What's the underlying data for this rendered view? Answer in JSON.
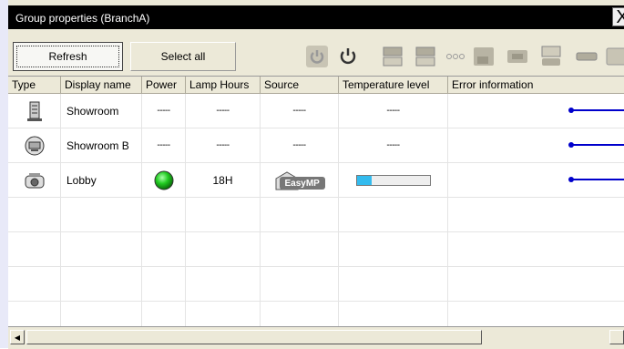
{
  "window": {
    "title": "Group properties (BranchA)",
    "close_glyph": "X"
  },
  "toolbar": {
    "refresh_label": "Refresh",
    "select_all_label": "Select all",
    "icons": [
      "power-on-icon",
      "power-off-icon",
      "computer-source-icon",
      "video-source-icon",
      "av-mute-icon",
      "freeze-icon",
      "display-icon",
      "usb-icon",
      "hdmi-icon",
      "more-icon"
    ]
  },
  "table": {
    "columns": [
      "Type",
      "Display name",
      "Power",
      "Lamp Hours",
      "Source",
      "Temperature level",
      "Error information"
    ],
    "rows": [
      {
        "type_icon": "building-icon",
        "name": "Showroom",
        "power": "-----",
        "lamp_hours": "-----",
        "source": "-----",
        "temperature": "-----",
        "temperature_level": null
      },
      {
        "type_icon": "monitor-icon",
        "name": "Showroom B",
        "power": "-----",
        "lamp_hours": "-----",
        "source": "-----",
        "temperature": "-----",
        "temperature_level": null
      },
      {
        "type_icon": "projector-icon",
        "name": "Lobby",
        "power": "on",
        "power_icon": "green-status-icon",
        "lamp_hours": "18H",
        "source": "EasyMP",
        "source_icon": "easymp-icon",
        "temperature": "",
        "temperature_level": 0.2
      }
    ]
  },
  "colors": {
    "accent_blue": "#0000cc",
    "power_green": "#22bb22",
    "temp_bar": "#33bbee"
  }
}
